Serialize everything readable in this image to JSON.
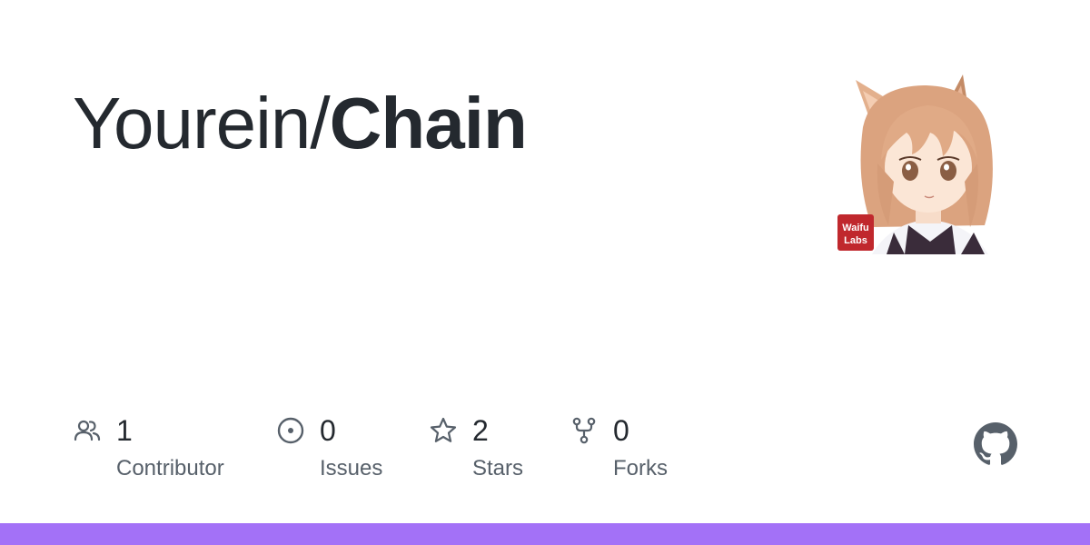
{
  "repo": {
    "owner": "Yourein/",
    "name": "Chain"
  },
  "avatar": {
    "badge_line1": "Waifu",
    "badge_line2": "Labs"
  },
  "stats": {
    "contributors": {
      "value": "1",
      "label": "Contributor",
      "icon": "people-icon"
    },
    "issues": {
      "value": "0",
      "label": "Issues",
      "icon": "issue-opened-icon"
    },
    "stars": {
      "value": "2",
      "label": "Stars",
      "icon": "star-icon"
    },
    "forks": {
      "value": "0",
      "label": "Forks",
      "icon": "repo-forked-icon"
    }
  },
  "footer": {
    "logo_icon": "github-mark-icon"
  },
  "colors": {
    "text_primary": "#24292f",
    "text_secondary": "#57606a",
    "icon": "#57606a",
    "accent_bar": "#a371f7",
    "github_logo": "#57606a"
  }
}
